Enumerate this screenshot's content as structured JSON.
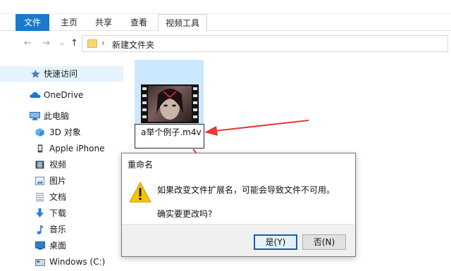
{
  "ribbon": {
    "tabs": [
      {
        "label": "文件"
      },
      {
        "label": "主页"
      },
      {
        "label": "共享"
      },
      {
        "label": "查看"
      },
      {
        "label": "视频工具"
      }
    ]
  },
  "address": {
    "back": "←",
    "forward": "→",
    "recent": "⌄",
    "up": "↑",
    "chevron": "›",
    "path": "新建文件夹"
  },
  "sidebar": {
    "items": [
      {
        "label": "快速访问",
        "icon": "star-icon"
      },
      {
        "label": "OneDrive",
        "icon": "cloud-icon"
      },
      {
        "label": "此电脑",
        "icon": "computer-icon"
      },
      {
        "label": "3D 对象",
        "icon": "cube-icon"
      },
      {
        "label": "Apple iPhone",
        "icon": "phone-icon"
      },
      {
        "label": "视频",
        "icon": "video-icon"
      },
      {
        "label": "图片",
        "icon": "pictures-icon"
      },
      {
        "label": "文档",
        "icon": "document-icon"
      },
      {
        "label": "下载",
        "icon": "download-icon"
      },
      {
        "label": "音乐",
        "icon": "music-icon"
      },
      {
        "label": "桌面",
        "icon": "desktop-icon"
      },
      {
        "label": "Windows (C:)",
        "icon": "drive-icon"
      }
    ]
  },
  "file": {
    "rename_value": "a举个例子.m4v"
  },
  "dialog": {
    "title": "重命名",
    "message": "如果改变文件扩展名，可能会导致文件不可用。",
    "confirm": "确实要更改吗?",
    "yes_label": "是(Y)",
    "no_label": "否(N)"
  },
  "colors": {
    "accent": "#1979ca",
    "selection": "#cce8ff",
    "annotation": "#e53935",
    "warning": "#f5c400"
  }
}
